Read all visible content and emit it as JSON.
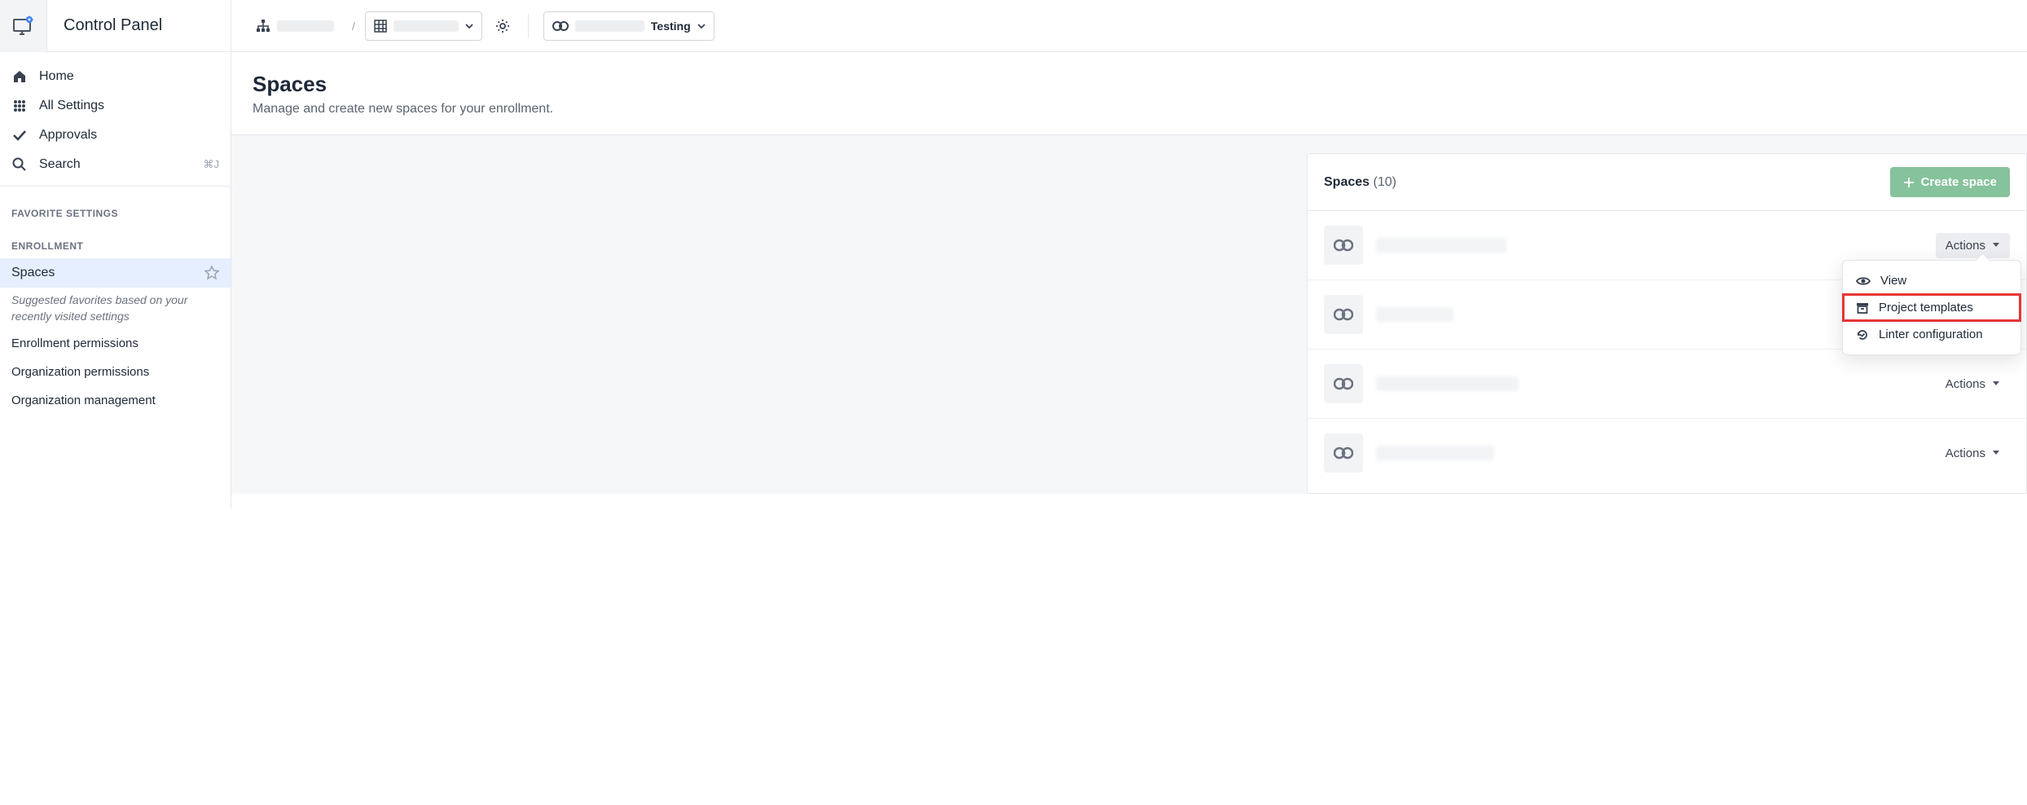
{
  "header": {
    "title": "Control Panel",
    "breadcrumb_redacted1": "",
    "breadcrumb_redacted2": "",
    "context_label": "Testing"
  },
  "sidebar": {
    "items": [
      {
        "label": "Home"
      },
      {
        "label": "All Settings"
      },
      {
        "label": "Approvals"
      },
      {
        "label": "Search",
        "shortcut": "⌘J"
      }
    ],
    "fav_section": "FAVORITE SETTINGS",
    "enroll_section": "ENROLLMENT",
    "spaces_label": "Spaces",
    "hint_text": "Suggested favorites based on your recently visited settings",
    "suggested": [
      {
        "label": "Enrollment permissions"
      },
      {
        "label": "Organization permissions"
      },
      {
        "label": "Organization management"
      }
    ]
  },
  "page": {
    "title": "Spaces",
    "subtitle": "Manage and create new spaces for your enrollment."
  },
  "panel": {
    "title": "Spaces",
    "count": "(10)",
    "create_btn": "Create space",
    "actions_label": "Actions"
  },
  "dropdown": {
    "view": "View",
    "project_templates": "Project templates",
    "linter": "Linter configuration"
  }
}
